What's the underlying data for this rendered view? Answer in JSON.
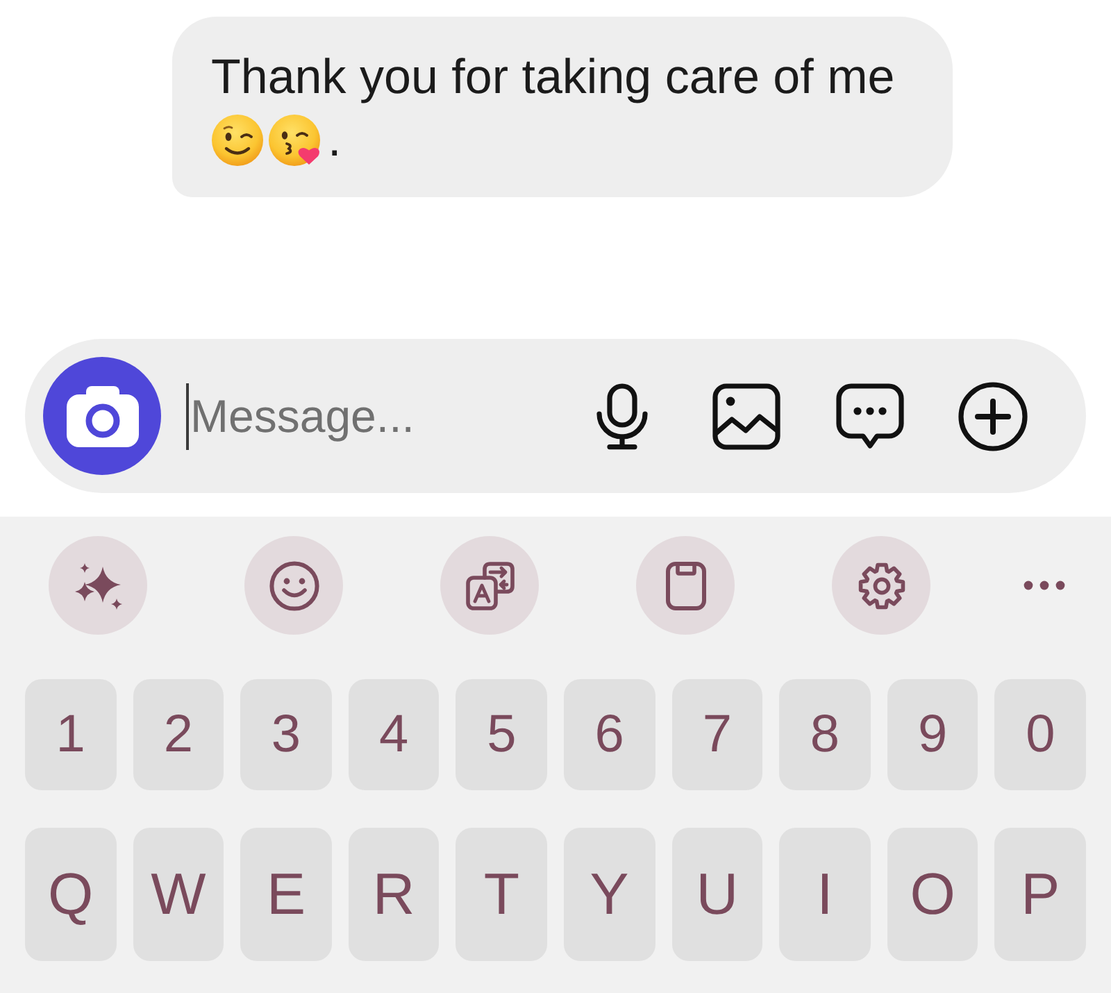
{
  "message": {
    "text": "Thank you for taking care of me",
    "trailing_text": "."
  },
  "composer": {
    "placeholder": "Message..."
  },
  "keyboard": {
    "number_row": [
      "1",
      "2",
      "3",
      "4",
      "5",
      "6",
      "7",
      "8",
      "9",
      "0"
    ],
    "letter_row": [
      "Q",
      "W",
      "E",
      "R",
      "T",
      "Y",
      "U",
      "I",
      "O",
      "P"
    ]
  }
}
